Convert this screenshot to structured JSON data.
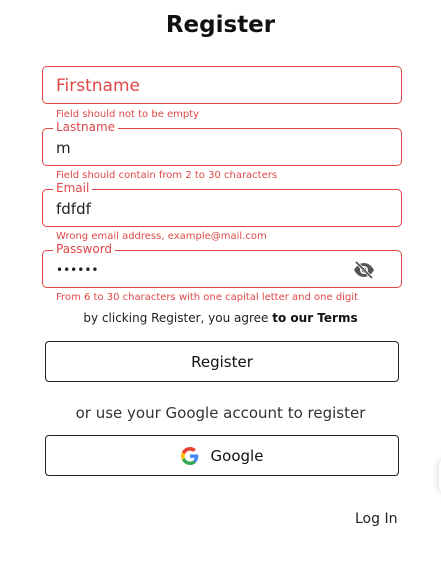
{
  "title": "Register",
  "firstname": {
    "placeholder": "Firstname",
    "error": "Field should not to be empty"
  },
  "lastname": {
    "label": "Lastname",
    "value": "m",
    "error": "Field should contain from 2 to 30 characters"
  },
  "email": {
    "label": "Email",
    "value": "fdfdf",
    "error": "Wrong email address, example@mail.com"
  },
  "password": {
    "label": "Password",
    "value": "••••••",
    "error": "From 6 to 30 characters with one capital letter and one digit",
    "toggle_icon": "eye-off-icon"
  },
  "terms": {
    "prefix": "by clicking Register, you agree ",
    "link": "to our Terms"
  },
  "register_button": "Register",
  "alt_text": "or use your Google account to register",
  "google_button": {
    "label": "Google",
    "icon": "google-logo-icon"
  },
  "login_link": "Log In",
  "colors": {
    "error": "#e04848",
    "border": "#222222",
    "background": "#ffffff"
  }
}
